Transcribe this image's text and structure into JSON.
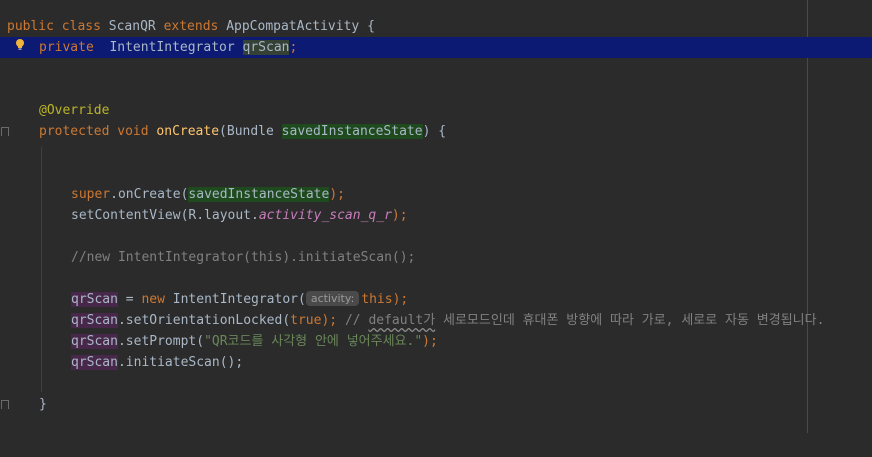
{
  "editor": {
    "language": "Java",
    "accent_colors": {
      "background": "#2b2b2b",
      "current_line": "#0d1a73",
      "keyword": "#cc7832",
      "method": "#ffc66d",
      "string": "#6a8759",
      "comment": "#808080",
      "annotation": "#bbb529",
      "field": "#c77dbb"
    },
    "icons": [
      "lightbulb-icon",
      "fold-marker-icon"
    ],
    "lines": {
      "l1": {
        "kw_public": "public",
        "kw_class": "class",
        "class_name": "ScanQR",
        "kw_extends": "extends",
        "parent": "AppCompatActivity",
        "brace": "{"
      },
      "l2": {
        "kw_private": "private",
        "type": "IntentIntegrator",
        "var": "qrScan",
        "semi": ";"
      },
      "l5": {
        "annotation": "@Override"
      },
      "l6": {
        "kw_protected": "protected",
        "kw_void": "void",
        "method": "onCreate",
        "open": "(",
        "param_type": "Bundle",
        "param": "savedInstanceState",
        "close": ")",
        "brace": "{"
      },
      "l9": {
        "kw_super": "super",
        "rest": ".onCreate(",
        "arg": "savedInstanceState",
        "end": ");"
      },
      "l10": {
        "prefix": "setContentView(R.layout.",
        "field": "activity_scan_q_r",
        "end": ");"
      },
      "l12": {
        "comment": "//new IntentIntegrator(this).initiateScan();"
      },
      "l14": {
        "var": "qrScan",
        "eq": " = ",
        "kw_new": "new",
        "ctor": "IntentIntegrator(",
        "hint": "activity:",
        "kw_this": "this",
        "end": ");"
      },
      "l15": {
        "var": "qrScan",
        "call": ".setOrientationLocked(",
        "kw_true": "true",
        "end": ");",
        "comment_start": " // ",
        "comment_word": "default가",
        "comment_rest": " 세로모드인데 휴대폰 방향에 따라 가로, 세로로 자동 변경됩니다."
      },
      "l16": {
        "var": "qrScan",
        "call": ".setPrompt(",
        "string": "\"QR코드를 사각형 안에 넣어주세요.\"",
        "end": ");"
      },
      "l17": {
        "var": "qrScan",
        "call": ".initiateScan();"
      },
      "l19": {
        "brace": "}"
      }
    }
  }
}
